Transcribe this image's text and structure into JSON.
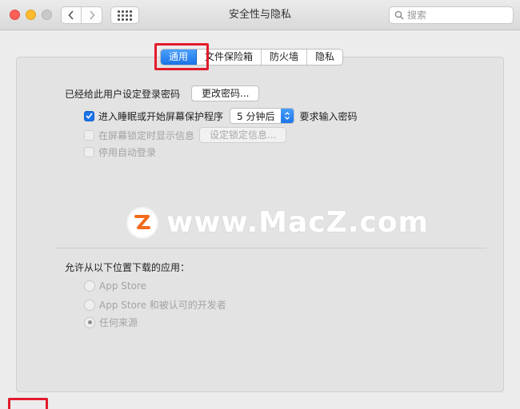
{
  "window": {
    "title": "安全性与隐私"
  },
  "search": {
    "placeholder": "搜索"
  },
  "tabs": [
    {
      "label": "通用",
      "active": true
    },
    {
      "label": "文件保险箱",
      "active": false
    },
    {
      "label": "防火墙",
      "active": false
    },
    {
      "label": "隐私",
      "active": false
    }
  ],
  "general": {
    "password_set_label": "已经给此用户设定登录密码",
    "change_password_button": "更改密码...",
    "require_password": {
      "label": "进入睡眠或开始屏幕保护程序",
      "checked": true,
      "delay_value": "5 分钟后",
      "suffix": "要求输入密码"
    },
    "show_message": {
      "label": "在屏幕锁定时显示信息",
      "checked": false,
      "button": "设定锁定信息..."
    },
    "disable_auto_login": {
      "label": "停用自动登录",
      "checked": false
    }
  },
  "downloads": {
    "label": "允许从以下位置下载的应用：",
    "options": [
      {
        "label": "App Store",
        "selected": false
      },
      {
        "label": "App Store 和被认可的开发者",
        "selected": false
      },
      {
        "label": "任何来源",
        "selected": true
      }
    ]
  },
  "watermark": {
    "logo_letter": "Z",
    "text": "www.MacZ.com"
  },
  "colors": {
    "accent": "#1a73e8",
    "highlight_red": "#e21b2b",
    "watermark_orange": "#f26b1d"
  }
}
